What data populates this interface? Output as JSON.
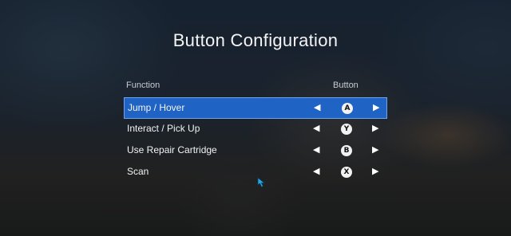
{
  "title": "Button Configuration",
  "columns": {
    "function": "Function",
    "button": "Button"
  },
  "rows": [
    {
      "label": "Jump / Hover",
      "button": "A",
      "selected": true
    },
    {
      "label": "Interact / Pick Up",
      "button": "Y",
      "selected": false
    },
    {
      "label": "Use Repair Cartridge",
      "button": "B",
      "selected": false
    },
    {
      "label": "Scan",
      "button": "X",
      "selected": false
    }
  ],
  "arrows": {
    "left": "◀",
    "right": "▶"
  },
  "colors": {
    "selection": "#1f63c4",
    "glyph": "#f2f2f2",
    "cursor": "#27a9e6"
  },
  "icons": {
    "cursor": "pointer-hand-icon"
  }
}
